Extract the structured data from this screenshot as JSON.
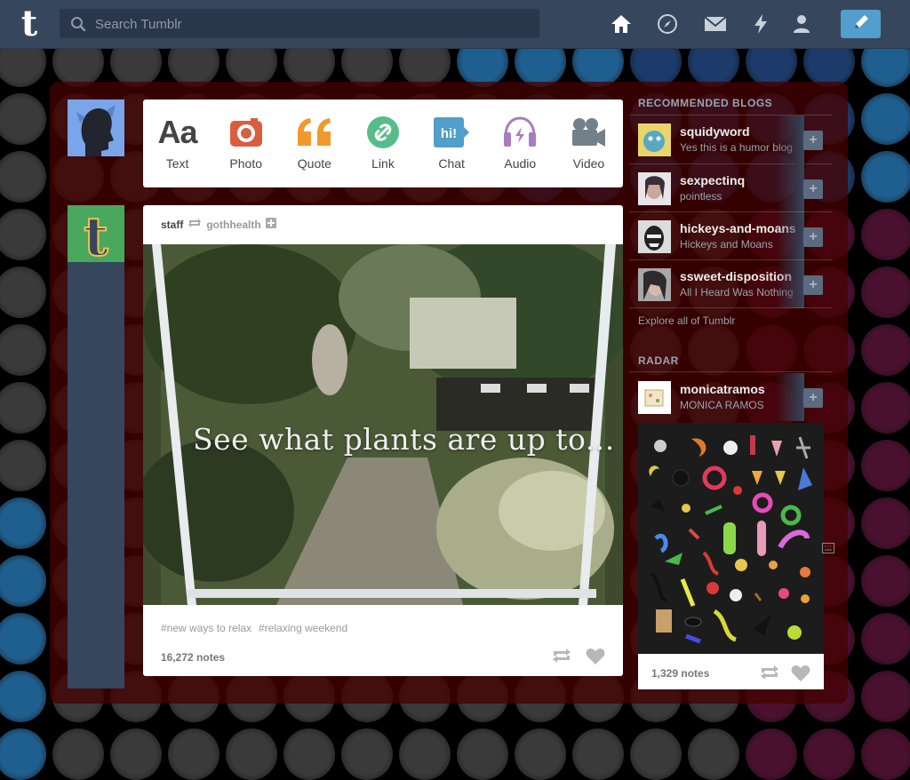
{
  "header": {
    "logo": "t",
    "search_placeholder": "Search Tumblr",
    "nav": [
      "home-icon",
      "explore-icon",
      "inbox-icon",
      "activity-icon",
      "account-icon"
    ],
    "compose_icon": "pencil-icon"
  },
  "post_types": [
    {
      "label": "Text",
      "icon": "Aa",
      "color": "#444444"
    },
    {
      "label": "Photo",
      "icon": "camera",
      "color": "#d95e40"
    },
    {
      "label": "Quote",
      "icon": "quote",
      "color": "#f2992e"
    },
    {
      "label": "Link",
      "icon": "link",
      "color": "#56bc8a"
    },
    {
      "label": "Chat",
      "icon": "hi!",
      "color": "#529ecc"
    },
    {
      "label": "Audio",
      "icon": "headphones",
      "color": "#a77dc2"
    },
    {
      "label": "Video",
      "icon": "video",
      "color": "#748089"
    }
  ],
  "post": {
    "author": "staff",
    "reblogged_from": "gothhealth",
    "photo_caption": "See what plants are up to...",
    "tags": [
      "#new ways to relax",
      "#relaxing weekend"
    ],
    "notes": "16,272 notes"
  },
  "sidebar": {
    "recommended_title": "RECOMMENDED BLOGS",
    "blogs": [
      {
        "name": "squidyword",
        "desc": "Yes this is a humor blog"
      },
      {
        "name": "sexpectinq",
        "desc": "pointless"
      },
      {
        "name": "hickeys-and-moans",
        "desc": "Hickeys and Moans"
      },
      {
        "name": "ssweet-disposition",
        "desc": "All I Heard Was Nothing"
      }
    ],
    "explore_label": "Explore all of Tumblr",
    "radar_title": "RADAR",
    "radar": {
      "name": "monicatramos",
      "desc": "MONICA RAMOS",
      "notes": "1,329 notes"
    }
  }
}
